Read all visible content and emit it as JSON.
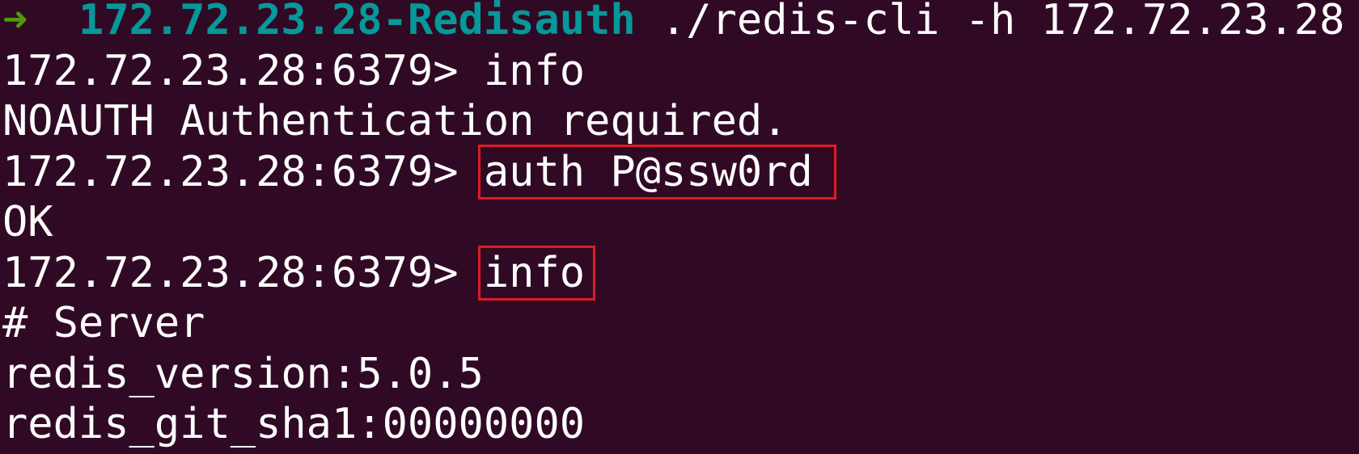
{
  "terminal": {
    "prompt_arrow": "➜",
    "prompt_host": "172.72.23.28-Redisauth",
    "prompt_command": "./redis-cli -h 172.72.23.28",
    "lines": {
      "l1_prompt": "172.72.23.28:6379> ",
      "l1_cmd": "info",
      "l2_output": "NOAUTH Authentication required.",
      "l3_prompt": "172.72.23.28:6379> ",
      "l3_cmd": "auth P@ssw0rd",
      "l4_output": "OK",
      "l5_prompt": "172.72.23.28:6379> ",
      "l5_cmd": "info",
      "l6_output": "# Server",
      "l7_output": "redis_version:5.0.5",
      "l8_output": "redis_git_sha1:00000000"
    },
    "colors": {
      "background": "#300a24",
      "arrow": "#4e9a06",
      "host": "#06989a",
      "highlight_box": "#e01b24"
    }
  }
}
